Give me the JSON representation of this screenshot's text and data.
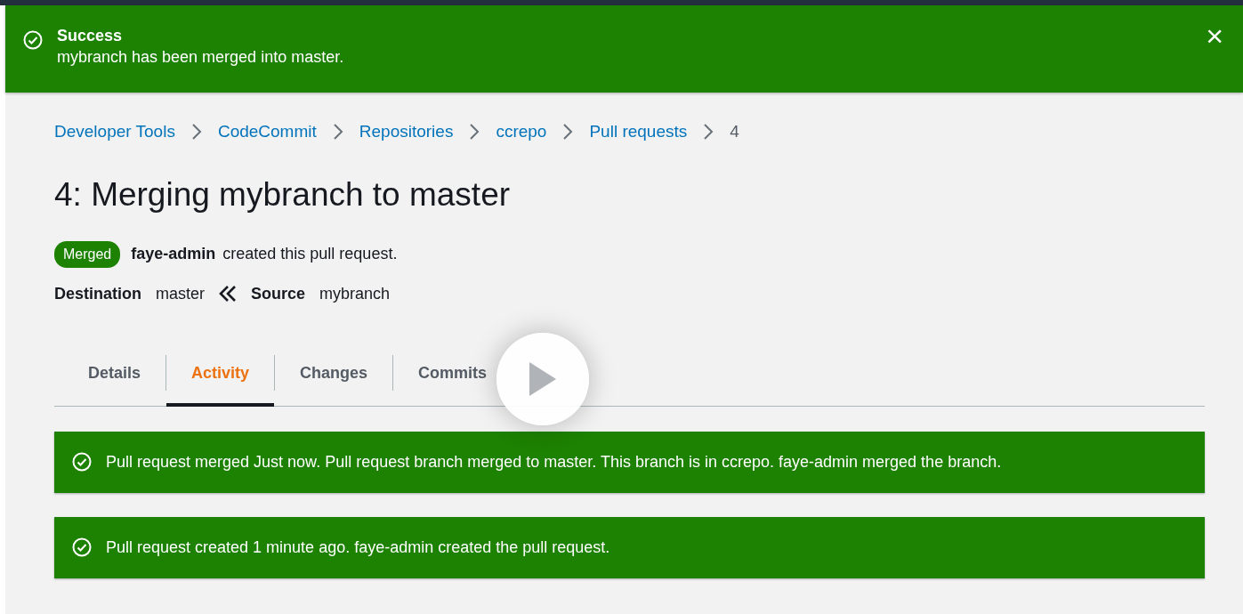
{
  "flash": {
    "title": "Success",
    "message": "mybranch has been merged into master.",
    "close": "×"
  },
  "breadcrumbs": [
    {
      "label": "Developer Tools",
      "link": true
    },
    {
      "label": "CodeCommit",
      "link": true
    },
    {
      "label": "Repositories",
      "link": true
    },
    {
      "label": "ccrepo",
      "link": true
    },
    {
      "label": "Pull requests",
      "link": true
    },
    {
      "label": "4",
      "link": false
    }
  ],
  "title": "4: Merging mybranch to master",
  "status_badge": "Merged",
  "author": "faye-admin",
  "author_text": "created this pull request.",
  "destination_label": "Destination",
  "destination": "master",
  "source_label": "Source",
  "source": "mybranch",
  "tabs": [
    {
      "label": "Details",
      "selected": false
    },
    {
      "label": "Activity",
      "selected": true
    },
    {
      "label": "Changes",
      "selected": false
    },
    {
      "label": "Commits",
      "selected": false
    }
  ],
  "activity": [
    {
      "text": "Pull request merged Just now. Pull request branch merged to master. This branch is in ccrepo. faye-admin merged the branch."
    },
    {
      "text": "Pull request created 1 minute ago. faye-admin created the pull request."
    }
  ]
}
